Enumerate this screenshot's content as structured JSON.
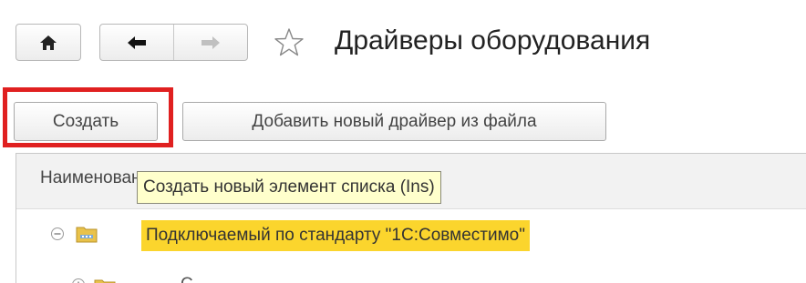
{
  "header": {
    "title": "Драйверы оборудования",
    "home_icon": "home-icon",
    "back_icon": "arrow-left-icon",
    "forward_icon": "arrow-right-icon",
    "favorite_icon": "star-outline-icon"
  },
  "toolbar": {
    "create_label": "Создать",
    "add_from_file_label": "Добавить новый драйвер из файла"
  },
  "list": {
    "column_header": "Наименование",
    "rows": [
      {
        "name": "Подключаемый по стандарту \"1С:Совместимо\"",
        "type": "group",
        "expanded": true,
        "highlighted": true
      },
      {
        "name": "С",
        "type": "group",
        "expanded": false,
        "highlighted": false
      }
    ]
  },
  "tooltip": {
    "text": "Создать новый элемент списка (Ins)"
  },
  "colors": {
    "highlight_box": "#e02020",
    "row_highlight": "#fbd52d",
    "tooltip_background": "#ffffcc",
    "folder": "#e9c24a"
  }
}
